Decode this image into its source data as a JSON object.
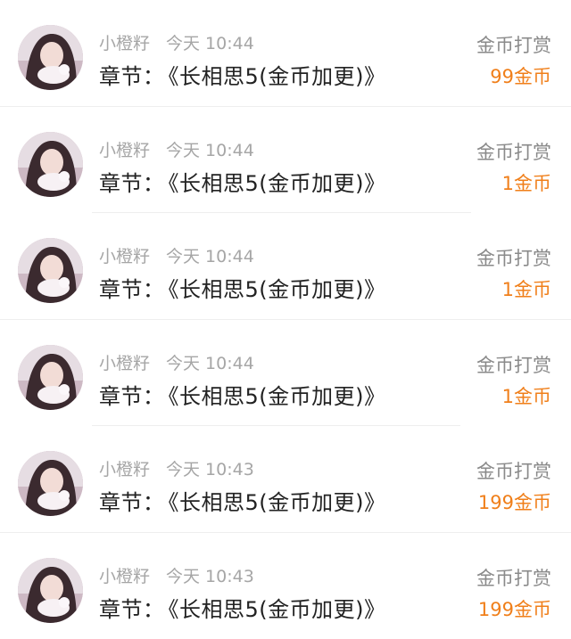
{
  "accent_color": "#f07f1a",
  "items": [
    {
      "user": "小橙籽",
      "time": "今天 10:44",
      "chapter_prefix": "章节：",
      "chapter_title": "《长相思5(金币加更)》",
      "reward_type": "金币打赏",
      "reward_amount": "99金币",
      "avatar_icon": "user-avatar-photo"
    },
    {
      "user": "小橙籽",
      "time": "今天 10:44",
      "chapter_prefix": "章节：",
      "chapter_title": "《长相思5(金币加更)》",
      "reward_type": "金币打赏",
      "reward_amount": "1金币",
      "avatar_icon": "user-avatar-photo"
    },
    {
      "user": "小橙籽",
      "time": "今天 10:44",
      "chapter_prefix": "章节：",
      "chapter_title": "《长相思5(金币加更)》",
      "reward_type": "金币打赏",
      "reward_amount": "1金币",
      "avatar_icon": "user-avatar-photo"
    },
    {
      "user": "小橙籽",
      "time": "今天 10:44",
      "chapter_prefix": "章节：",
      "chapter_title": "《长相思5(金币加更)》",
      "reward_type": "金币打赏",
      "reward_amount": "1金币",
      "avatar_icon": "user-avatar-photo"
    },
    {
      "user": "小橙籽",
      "time": "今天 10:43",
      "chapter_prefix": "章节：",
      "chapter_title": "《长相思5(金币加更)》",
      "reward_type": "金币打赏",
      "reward_amount": "199金币",
      "avatar_icon": "user-avatar-photo"
    },
    {
      "user": "小橙籽",
      "time": "今天 10:43",
      "chapter_prefix": "章节：",
      "chapter_title": "《长相思5(金币加更)》",
      "reward_type": "金币打赏",
      "reward_amount": "199金币",
      "avatar_icon": "user-avatar-photo"
    }
  ]
}
